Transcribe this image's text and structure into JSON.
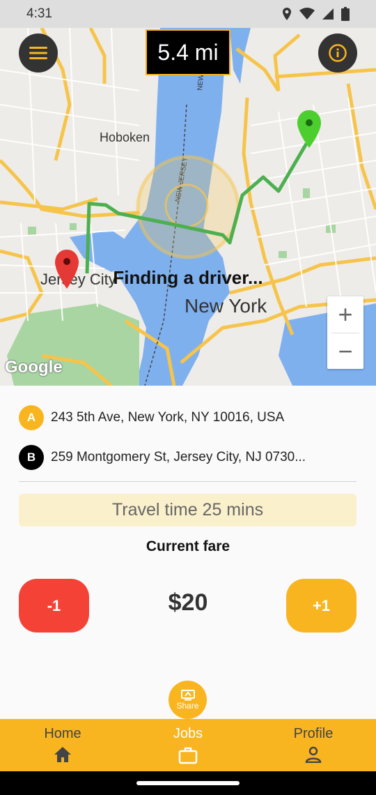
{
  "status_bar": {
    "time": "4:31"
  },
  "map": {
    "distance": "5.4 mi",
    "status_text": "Finding a driver...",
    "labels": {
      "hoboken": "Hoboken",
      "jersey_city": "Jersey City",
      "new_york": "New York",
      "new_jersey_river": "NEW JERSEY",
      "new_river": "NEW"
    },
    "zoom_in": "+",
    "zoom_out": "−",
    "attribution": "Google"
  },
  "addresses": [
    {
      "badge": "A",
      "text": "243 5th Ave, New York, NY 10016, USA"
    },
    {
      "badge": "B",
      "text": "259 Montgomery St, Jersey City, NJ 0730..."
    }
  ],
  "travel_time": "Travel time 25 mins",
  "fare": {
    "label": "Current fare",
    "value": "$20",
    "minus": "-1",
    "plus": "+1"
  },
  "share": {
    "label": "Share"
  },
  "nav": [
    {
      "label": "Home",
      "icon": "home-icon"
    },
    {
      "label": "Jobs",
      "icon": "briefcase-icon"
    },
    {
      "label": "Profile",
      "icon": "person-icon"
    }
  ],
  "colors": {
    "accent": "#f9b51f",
    "danger": "#f44336",
    "route": "#4caf50",
    "dark": "#333333"
  }
}
